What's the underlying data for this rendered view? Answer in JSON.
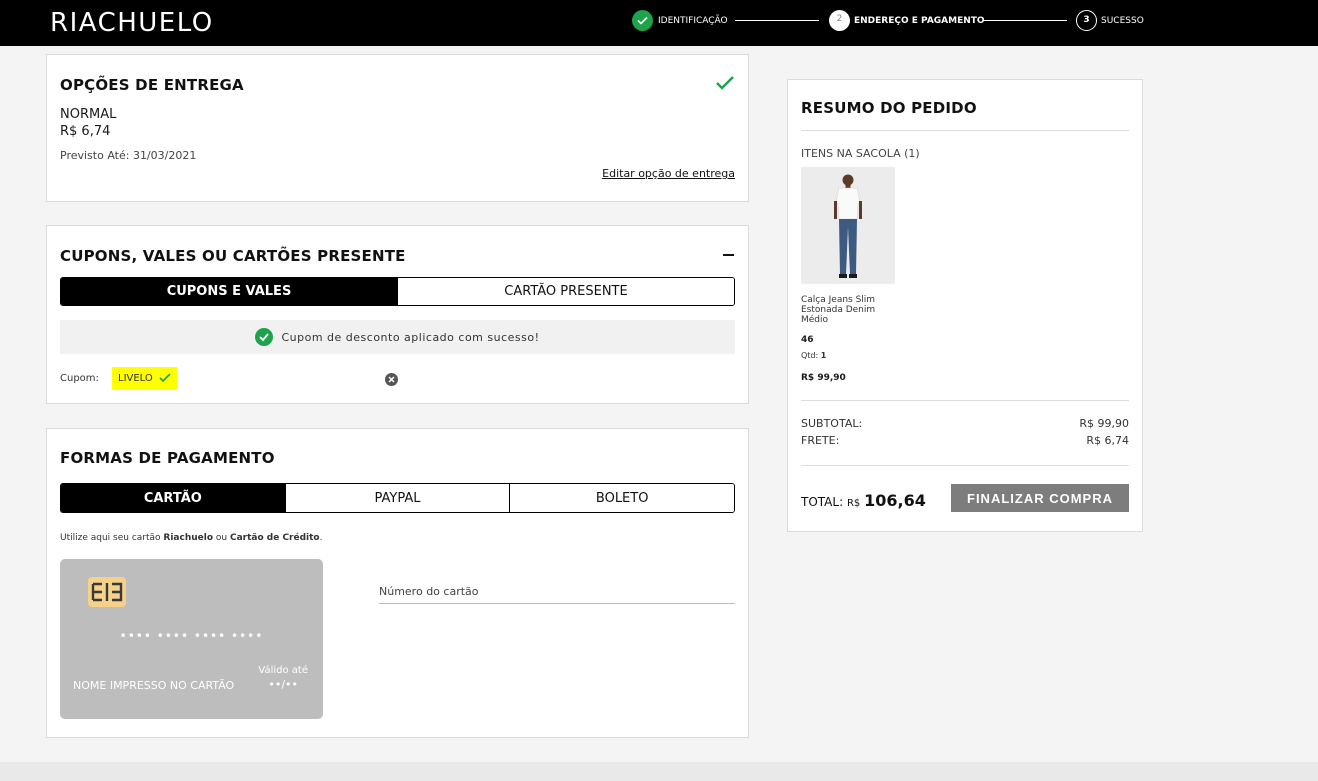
{
  "header": {
    "logo": "RIACHUELO",
    "steps": [
      {
        "number": "",
        "label": "IDENTIFICAÇÃO"
      },
      {
        "number": "2",
        "label": "ENDEREÇO E PAGAMENTO"
      },
      {
        "number": "3",
        "label": "SUCESSO"
      }
    ]
  },
  "delivery": {
    "title": "OPÇÕES DE ENTREGA",
    "option_name": "NORMAL",
    "option_price": "R$ 6,74",
    "forecast": "Previsto Até: 31/03/2021",
    "edit_link": "Editar opção de entrega"
  },
  "coupons": {
    "title": "CUPONS, VALES OU CARTÕES PRESENTE",
    "tabs": [
      "CUPONS E VALES",
      "CARTÃO PRESENTE"
    ],
    "success_message": "Cupom de desconto aplicado com sucesso!",
    "coupon_label": "Cupom:",
    "coupon_code": "LIVELO"
  },
  "payment": {
    "title": "FORMAS DE PAGAMENTO",
    "tabs": [
      "CARTÃO",
      "PAYPAL",
      "BOLETO"
    ],
    "hint_prefix": "Utilize aqui seu cartão ",
    "hint_brand": "Riachuelo",
    "hint_middle": " ou ",
    "hint_credit": "Cartão de Crédito",
    "hint_suffix": ".",
    "card_number_mask": "•••• •••• •••• ••••",
    "card_name": "NOME IMPRESSO NO CARTÃO",
    "card_valid_label": "Válido até",
    "card_valid_value": "••/••",
    "card_number_field": "Número do cartão"
  },
  "summary": {
    "title": "RESUMO DO PEDIDO",
    "items_label": "ITENS NA SACOLA (1)",
    "product_name": "Calça Jeans Slim Estonada Denim Médio",
    "product_size": "46",
    "qty_label": "Qtd:",
    "qty_value": "1",
    "product_price": "R$ 99,90",
    "subtotal_label": "SUBTOTAL:",
    "subtotal_value": "R$ 99,90",
    "shipping_label": "FRETE:",
    "shipping_value": "R$ 6,74",
    "total_label": "TOTAL:",
    "total_currency": "R$",
    "total_value": "106,64",
    "finalize_label": "FINALIZAR COMPRA"
  },
  "colors": {
    "success": "#1ea34a",
    "coupon_highlight": "#ffff00",
    "header_bg": "#000000",
    "finalize_bg": "#7d7d7d",
    "card_bg": "#bdbdbd",
    "chip": "#f5d18a"
  }
}
